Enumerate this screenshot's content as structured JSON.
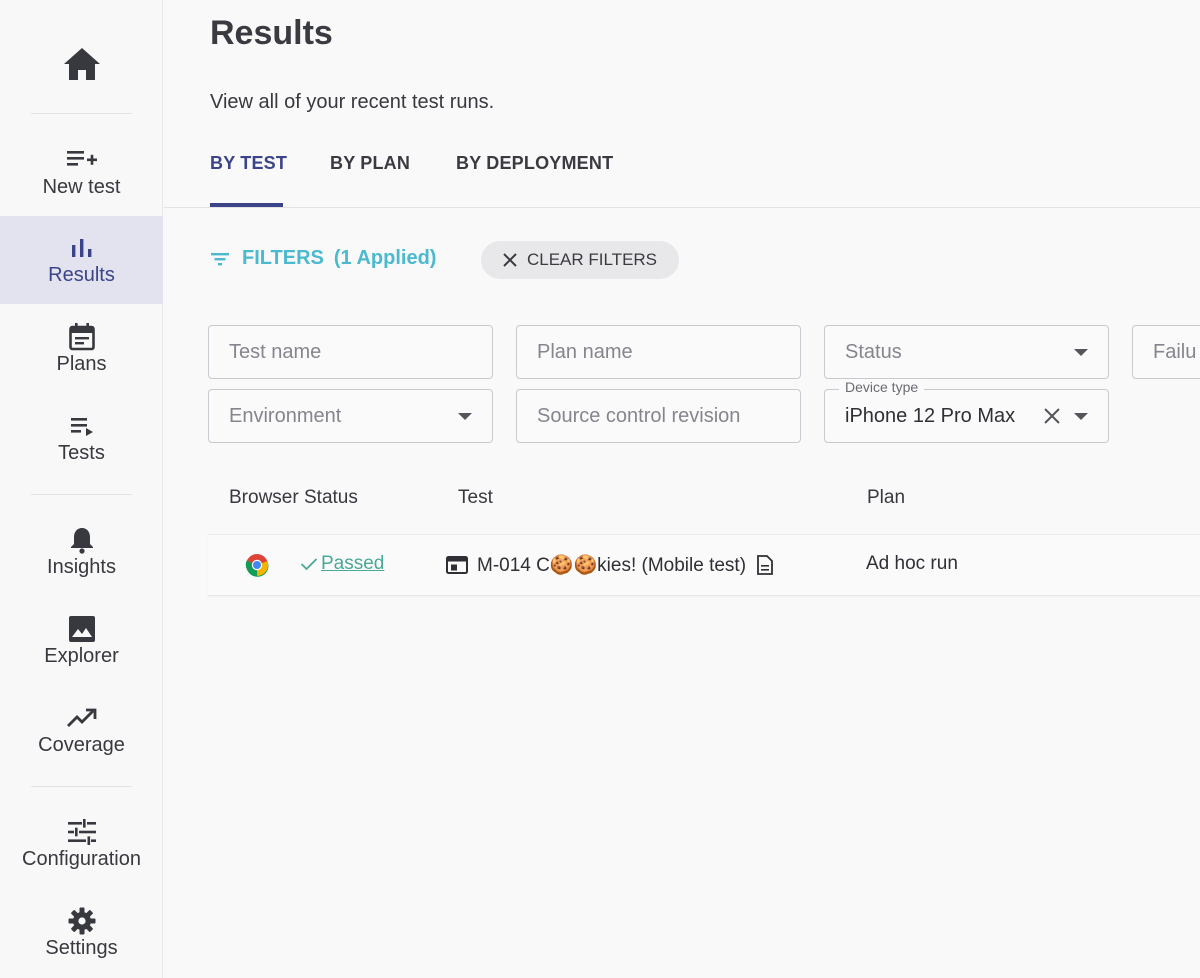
{
  "sidebar": {
    "items": [
      {
        "label": "New test"
      },
      {
        "label": "Results"
      },
      {
        "label": "Plans"
      },
      {
        "label": "Tests"
      },
      {
        "label": "Insights"
      },
      {
        "label": "Explorer"
      },
      {
        "label": "Coverage"
      },
      {
        "label": "Configuration"
      },
      {
        "label": "Settings"
      }
    ],
    "active_label": "Results"
  },
  "header": {
    "title": "Results",
    "subtitle": "View all of your recent test runs."
  },
  "tabs": [
    {
      "label": "BY TEST",
      "active": true
    },
    {
      "label": "BY PLAN",
      "active": false
    },
    {
      "label": "BY DEPLOYMENT",
      "active": false
    }
  ],
  "filters": {
    "toggle_label": "FILTERS",
    "applied_label": "(1 Applied)",
    "clear_label": "CLEAR FILTERS",
    "fields": {
      "test_name": {
        "placeholder": "Test name"
      },
      "plan_name": {
        "placeholder": "Plan name"
      },
      "status": {
        "placeholder": "Status"
      },
      "failure": {
        "placeholder": "Failu"
      },
      "environment": {
        "placeholder": "Environment"
      },
      "source_control": {
        "placeholder": "Source control revision"
      },
      "device_type": {
        "legend": "Device type",
        "value": "iPhone 12 Pro Max"
      }
    }
  },
  "table": {
    "columns": [
      "Browser",
      "Status",
      "Test",
      "Plan"
    ],
    "rows": [
      {
        "browser_icon": "chrome-icon",
        "status": "Passed",
        "test": "M-014 C🍪🍪kies! (Mobile test)",
        "plan": "Ad hoc run"
      }
    ]
  },
  "colors": {
    "accent": "#3c4489",
    "active_nav_bg": "#e2e3ef",
    "filter_teal": "#4bb9ce",
    "passed_green": "#4aa897"
  }
}
